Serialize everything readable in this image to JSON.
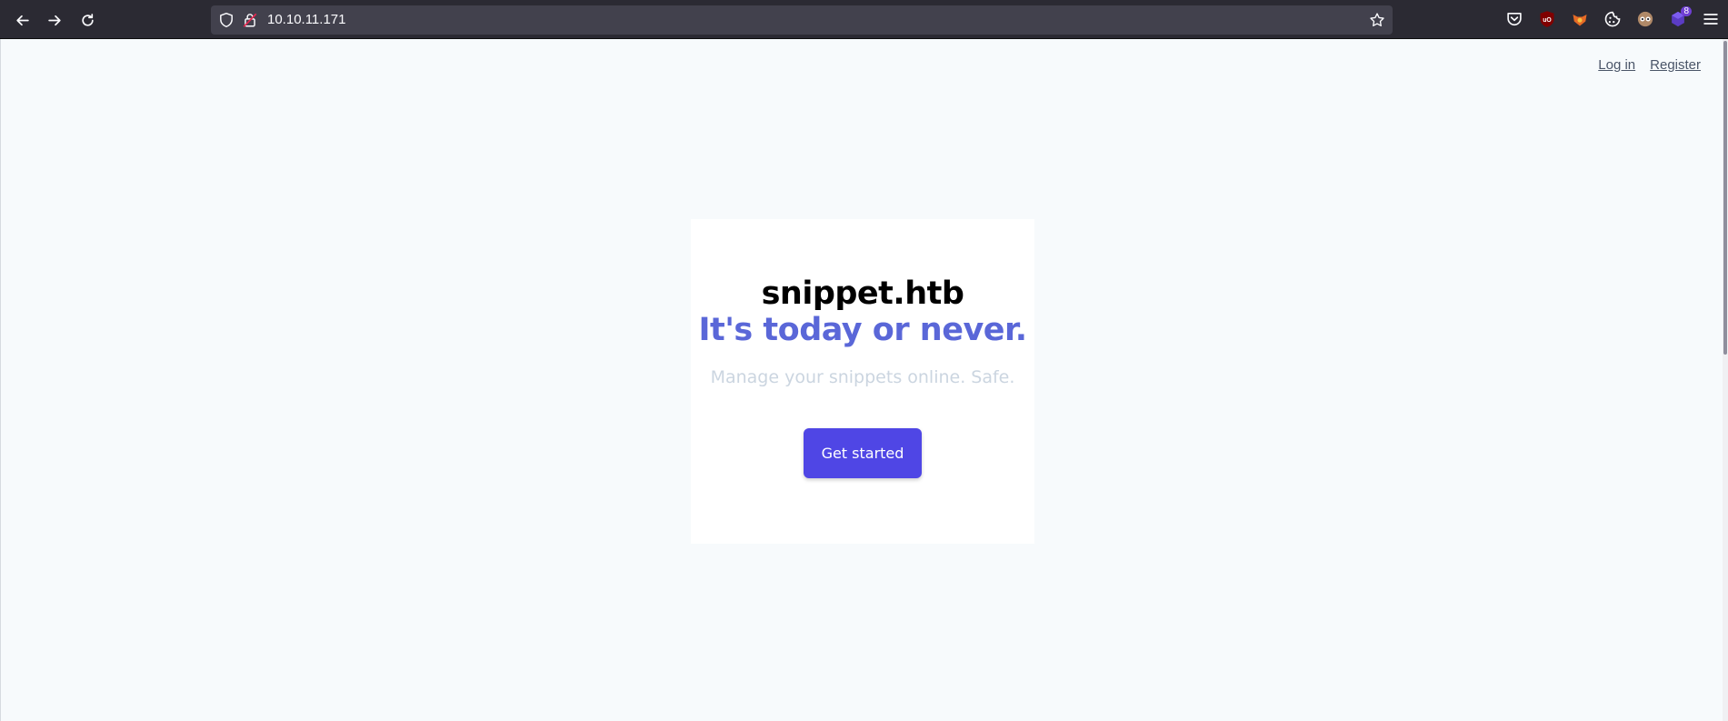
{
  "browser": {
    "url": "10.10.11.171",
    "extension_badge": "8"
  },
  "nav": {
    "login_label": "Log in",
    "register_label": "Register"
  },
  "hero": {
    "brand": "snippet.htb",
    "slogan": "It's today or never.",
    "tagline": "Manage your snippets online. Safe.",
    "cta_label": "Get started"
  },
  "colors": {
    "chrome_bg": "#2b2a33",
    "urlbar_bg": "#42414d",
    "page_bg": "#f7fafc",
    "slogan": "#5a67d8",
    "cta_bg": "#4f46e5",
    "tagline": "#cbd5e0"
  },
  "icons": {
    "toolbar": [
      "back-icon",
      "forward-icon",
      "reload-icon",
      "shield-icon",
      "lock-icon",
      "bookmark-star-icon",
      "pocket-icon",
      "ublock-icon",
      "foxyproxy-icon",
      "cookie-icon",
      "wappalyzer-icon",
      "extension-icon",
      "menu-icon"
    ]
  }
}
